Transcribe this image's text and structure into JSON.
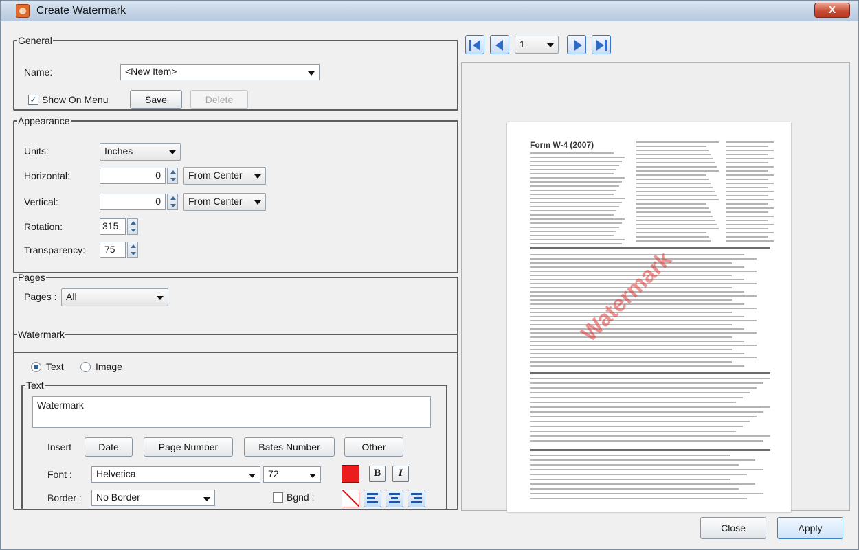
{
  "window": {
    "title": "Create Watermark",
    "close_glyph": "X"
  },
  "general": {
    "legend": "General",
    "name_label": "Name:",
    "name_value": "<New Item>",
    "show_on_menu_label": "Show On Menu",
    "show_on_menu_checked": true,
    "save_label": "Save",
    "delete_label": "Delete"
  },
  "appearance": {
    "legend": "Appearance",
    "units_label": "Units:",
    "units_value": "Inches",
    "horizontal_label": "Horizontal:",
    "horizontal_value": "0",
    "horizontal_anchor": "From Center",
    "vertical_label": "Vertical:",
    "vertical_value": "0",
    "vertical_anchor": "From Center",
    "rotation_label": "Rotation:",
    "rotation_value": "315",
    "transparency_label": "Transparency:",
    "transparency_value": "75"
  },
  "pages": {
    "legend": "Pages",
    "pages_label": "Pages :",
    "pages_value": "All"
  },
  "watermark": {
    "legend": "Watermark",
    "type_text_label": "Text",
    "type_image_label": "Image",
    "selected_type": "Text",
    "text_group_legend": "Text",
    "text_value": "Watermark",
    "insert_label": "Insert",
    "date_label": "Date",
    "page_number_label": "Page Number",
    "bates_number_label": "Bates Number",
    "other_label": "Other",
    "font_label": "Font :",
    "font_value": "Helvetica",
    "font_size_value": "72",
    "font_color": "#ea1c1c",
    "bold_label": "B",
    "italic_label": "I",
    "border_label": "Border :",
    "border_value": "No Border",
    "bgnd_label": "Bgnd :"
  },
  "preview": {
    "page_value": "1",
    "nav_icons": [
      "first-page-icon",
      "previous-page-icon",
      "next-page-icon",
      "last-page-icon"
    ],
    "document_title": "Form W-4 (2007)",
    "watermark_text": "Watermark"
  },
  "footer": {
    "close_label": "Close",
    "apply_label": "Apply"
  }
}
